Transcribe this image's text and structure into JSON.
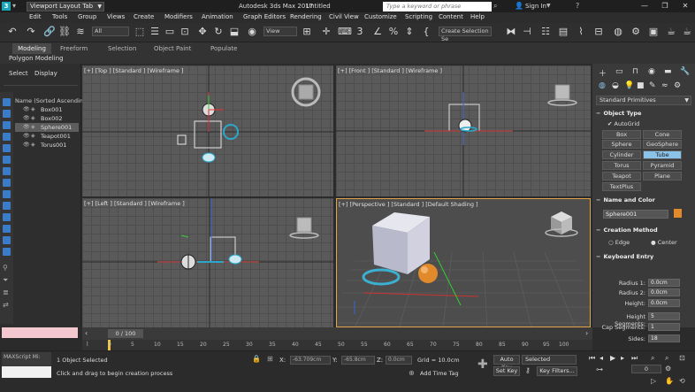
{
  "titlebar": {
    "app_icon": "3",
    "workspace": "Viewport Layout Tab",
    "app_title": "Autodesk 3ds Max 2017",
    "doc_title": "Untitled",
    "search_placeholder": "Type a keyword or phrase",
    "signin": "Sign In",
    "help_icon": "?",
    "minimize": "—",
    "restore": "❐",
    "close": "✕"
  },
  "menu": [
    "Edit",
    "Tools",
    "Group",
    "Views",
    "Create",
    "Modifiers",
    "Animation",
    "Graph Editors",
    "Rendering",
    "Civil View",
    "Customize",
    "Scripting",
    "Content",
    "Help"
  ],
  "toolbar": {
    "filter": "All",
    "ref_coord": "View",
    "named_sel": "Create Selection Se",
    "snap_3": "3",
    "snap_2_5": "2.5"
  },
  "ribbon": {
    "tabs": [
      "Modeling",
      "Freeform",
      "Selection",
      "Object Paint",
      "Populate"
    ],
    "subtitle": "Polygon Modeling"
  },
  "explorer": {
    "menu": [
      "Select",
      "Display"
    ],
    "header": "Name (Sorted Ascending)",
    "items": [
      "Box001",
      "Box002",
      "Sphere001",
      "Teapot001",
      "Torus001"
    ],
    "selected": "Sphere001",
    "maxscript": "MAXScript Mi:"
  },
  "viewports": {
    "top": "[+] [Top ] [Standard ] [Wireframe ]",
    "front": "[+] [Front ] [Standard ] [Wireframe ]",
    "left": "[+] [Left ] [Standard ] [Wireframe ]",
    "persp": "[+] [Perspective ] [Standard ] [Default Shading ]"
  },
  "command_panel": {
    "category": "Standard Primitives",
    "object_type": "Object Type",
    "autogrid": "AutoGrid",
    "buttons": [
      "Box",
      "Cone",
      "Sphere",
      "GeoSphere",
      "Cylinder",
      "Tube",
      "Torus",
      "Pyramid",
      "Teapot",
      "Plane",
      "TextPlus"
    ],
    "active_button": "Tube",
    "name_color": "Name and Color",
    "object_name": "Sphere001",
    "creation_method": "Creation Method",
    "methods": [
      "Edge",
      "Center"
    ],
    "keyboard_entry": "Keyboard Entry",
    "ke_labels": [
      "Radius 1:",
      "Radius 2:",
      "Height:",
      "Height Segments:",
      "Cap Segments:",
      "Sides:"
    ],
    "ke_values": [
      "0.0cm",
      "0.0cm",
      "0.0cm",
      "5",
      "1",
      "18"
    ],
    "color_swatch": "#e08a2c"
  },
  "timeline": {
    "slider": "0 / 100",
    "ticks": [
      "0",
      "5",
      "10",
      "15",
      "20",
      "25",
      "30",
      "35",
      "40",
      "45",
      "50",
      "55",
      "60",
      "65",
      "70",
      "75",
      "80",
      "85",
      "90",
      "95",
      "100"
    ]
  },
  "status": {
    "selection": "1 Object Selected",
    "prompt": "Click and drag to begin creation process",
    "x_label": "X:",
    "x_val": "-63.709cm",
    "y_label": "Y:",
    "y_val": "-65.8cm",
    "z_label": "Z:",
    "z_val": "0.0cm",
    "grid": "Grid = 10.0cm",
    "add_time_tag": "Add Time Tag",
    "auto_key": "Auto Key",
    "set_key": "Set Key",
    "key_mode": "Selected",
    "key_filters": "Key Filters...",
    "frame": "0"
  },
  "colors": {
    "accent": "#1aa6b7",
    "active_viewport": "#e4a54a",
    "active_button": "#8bc3e8",
    "sphere": "#e08a2c"
  }
}
